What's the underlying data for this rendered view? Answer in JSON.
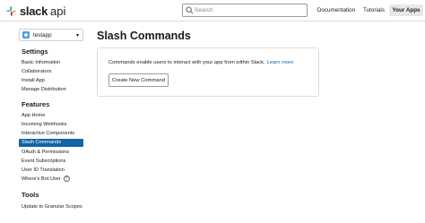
{
  "header": {
    "logo_word": "slack",
    "logo_suffix": "api",
    "search_placeholder": "Search",
    "nav": {
      "documentation": "Documentation",
      "tutorials": "Tutorials",
      "your_apps": "Your Apps"
    }
  },
  "sidebar": {
    "app_name": "testapp",
    "sections": [
      {
        "title": "Settings",
        "items": [
          "Basic Information",
          "Collaborators",
          "Install App",
          "Manage Distribution"
        ]
      },
      {
        "title": "Features",
        "items": [
          "App Home",
          "Incoming Webhooks",
          "Interactive Components",
          "Slash Commands",
          "OAuth & Permissions",
          "Event Subscriptions",
          "User ID Translation",
          "Where's Bot User"
        ]
      },
      {
        "title": "Tools",
        "items": [
          "Update to Granular Scopes"
        ]
      }
    ],
    "active_item": "Slash Commands"
  },
  "main": {
    "title": "Slash Commands",
    "description": "Commands enable users to interact with your app from within Slack.",
    "learn_more": "Learn more.",
    "create_button": "Create New Command"
  },
  "colors": {
    "accent": "#1264a3",
    "text": "#1d1c1d",
    "border": "#dddddd"
  },
  "icons": [
    "slack-logo-icon",
    "search-icon",
    "app-icon",
    "chevron-down-icon",
    "help-circle-icon"
  ]
}
